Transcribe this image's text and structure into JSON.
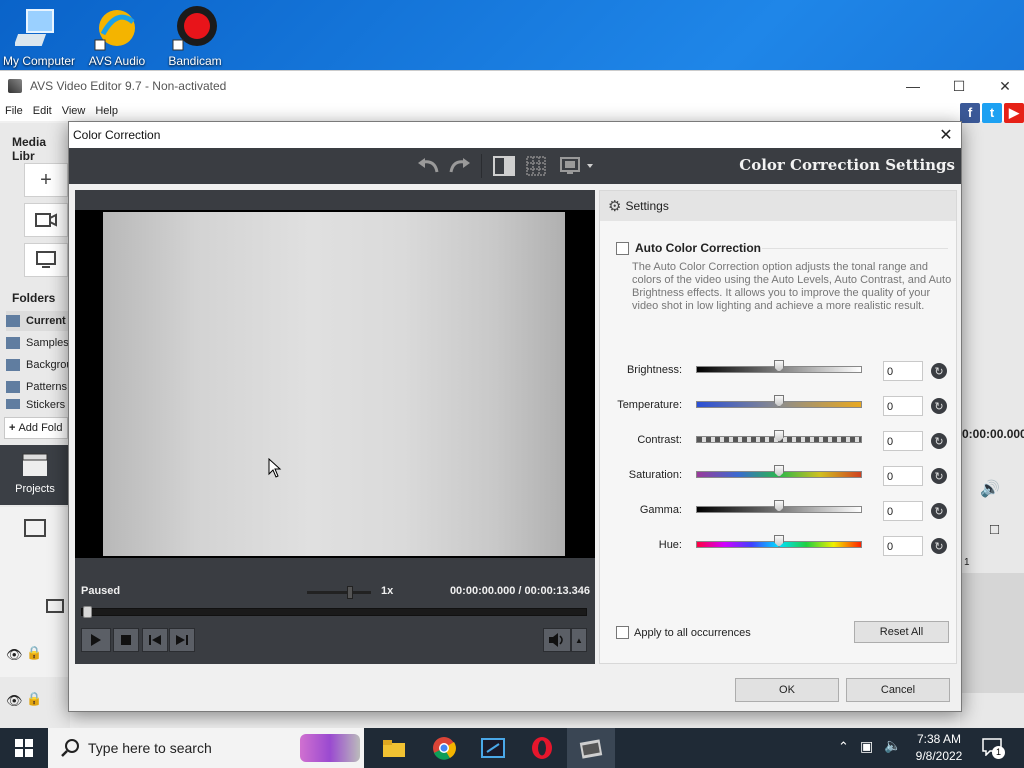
{
  "desktop": {
    "icons": [
      {
        "label": "My Computer"
      },
      {
        "label": "AVS Audio"
      },
      {
        "label": "Bandicam"
      }
    ]
  },
  "app": {
    "title": "AVS Video Editor 9.7 - Non-activated",
    "menu": [
      "File",
      "Edit",
      "View",
      "Help"
    ],
    "media_library_label": "Media Libr",
    "folders_label": "Folders",
    "folders": [
      "Current",
      "Samples",
      "Backgrou",
      "Patterns",
      "Stickers"
    ],
    "add_folder_label": "Add Fold",
    "projects_label": "Projects",
    "right_time": "0:00:00.000",
    "right_ruler": "1"
  },
  "dialog": {
    "title": "Color Correction",
    "heading": "Color Correction Settings",
    "player": {
      "status": "Paused",
      "speed": "1x",
      "time": "00:00:00.000  /  00:00:13.346"
    },
    "settings": {
      "header": "Settings",
      "auto_title": "Auto Color Correction",
      "auto_desc": "The Auto Color Correction option adjusts the tonal range and colors of the video using the Auto Levels, Auto Contrast, and Auto Brightness effects. It allows you to improve the quality of your video shot in low lighting and achieve a more realistic result.",
      "sliders": [
        {
          "label": "Brightness:",
          "value": "0"
        },
        {
          "label": "Temperature:",
          "value": "0"
        },
        {
          "label": "Contrast:",
          "value": "0"
        },
        {
          "label": "Saturation:",
          "value": "0"
        },
        {
          "label": "Gamma:",
          "value": "0"
        },
        {
          "label": "Hue:",
          "value": "0"
        }
      ],
      "apply_all": "Apply to all occurrences",
      "reset_all": "Reset All"
    },
    "ok": "OK",
    "cancel": "Cancel"
  },
  "taskbar": {
    "search_placeholder": "Type here to search",
    "time": "7:38 AM",
    "date": "9/8/2022",
    "notification_count": "1"
  }
}
